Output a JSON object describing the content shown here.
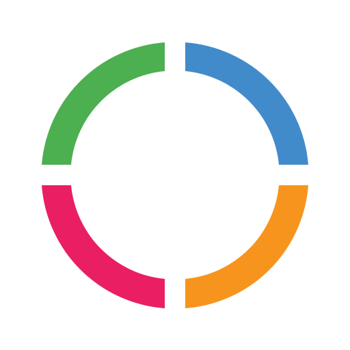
{
  "logo": {
    "icon": "quadrant-ring-logo",
    "segments": [
      {
        "name": "top-left",
        "color": "#4CAF50"
      },
      {
        "name": "top-right",
        "color": "#428BCA"
      },
      {
        "name": "bottom-left",
        "color": "#E91E63"
      },
      {
        "name": "bottom-right",
        "color": "#F7941D"
      }
    ]
  }
}
